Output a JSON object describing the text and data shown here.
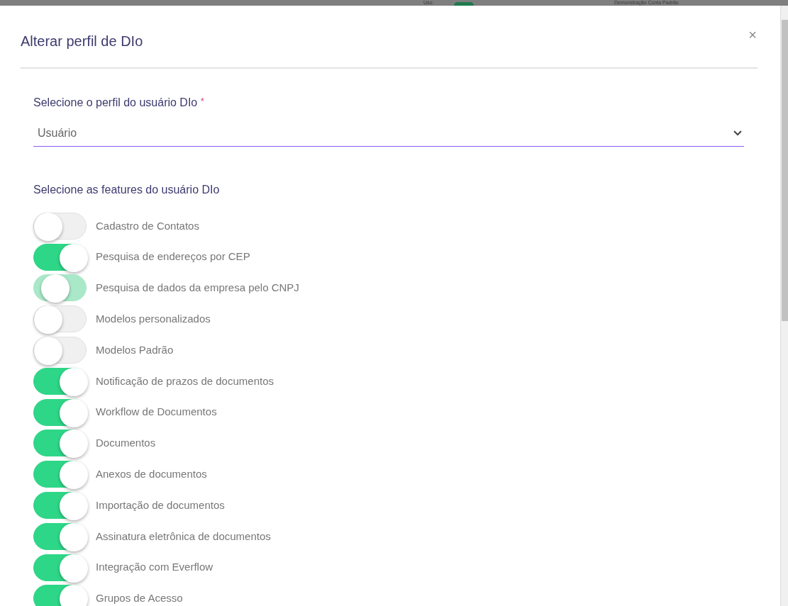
{
  "background": {
    "usage_label": "Uso:",
    "account": "Demonstração Conta Padrão"
  },
  "dialog": {
    "title": "Alterar perfil de DIo",
    "close": "×",
    "profile": {
      "label": "Selecione o perfil do usuário DIo",
      "required": "*",
      "value": "Usuário"
    },
    "features_heading": "Selecione as features do usuário DIo",
    "features": [
      {
        "label": "Cadastro de Contatos",
        "on": false,
        "highlighted": false
      },
      {
        "label": "Pesquisa de endereços por CEP",
        "on": true,
        "highlighted": false
      },
      {
        "label": "Pesquisa de dados da empresa pelo CNPJ",
        "on": false,
        "highlighted": true
      },
      {
        "label": "Modelos personalizados",
        "on": false,
        "highlighted": false
      },
      {
        "label": "Modelos Padrão",
        "on": false,
        "highlighted": false
      },
      {
        "label": "Notificação de prazos de documentos",
        "on": true,
        "highlighted": false
      },
      {
        "label": "Workflow de Documentos",
        "on": true,
        "highlighted": false
      },
      {
        "label": "Documentos",
        "on": true,
        "highlighted": false
      },
      {
        "label": "Anexos de documentos",
        "on": true,
        "highlighted": false
      },
      {
        "label": "Importação de documentos",
        "on": true,
        "highlighted": false
      },
      {
        "label": "Assinatura eletrônica de documentos",
        "on": true,
        "highlighted": false
      },
      {
        "label": "Integração com Everflow",
        "on": true,
        "highlighted": false
      },
      {
        "label": "Grupos de Acesso",
        "on": true,
        "highlighted": false
      }
    ]
  }
}
